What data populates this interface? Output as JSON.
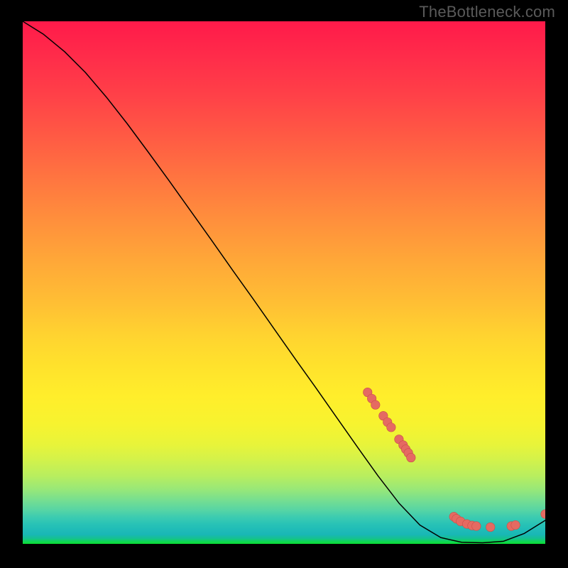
{
  "watermark": "TheBottleneck.com",
  "colors": {
    "curve": "#000000",
    "dot_fill": "#e56a62",
    "dot_stroke": "#c84f48",
    "bg_top": "#ff1a4a",
    "bg_bottom": "#0ce032",
    "page_bg": "#000000"
  },
  "chart_data": {
    "type": "line",
    "title": "",
    "xlabel": "",
    "ylabel": "",
    "xlim": [
      0,
      100
    ],
    "ylim": [
      0,
      100
    ],
    "grid": false,
    "legend": false,
    "curve": [
      {
        "x": 0.0,
        "y": 100.0
      },
      {
        "x": 4.0,
        "y": 97.5
      },
      {
        "x": 8.0,
        "y": 94.2
      },
      {
        "x": 12.0,
        "y": 90.2
      },
      {
        "x": 16.0,
        "y": 85.5
      },
      {
        "x": 20.0,
        "y": 80.4
      },
      {
        "x": 24.0,
        "y": 75.0
      },
      {
        "x": 28.0,
        "y": 69.5
      },
      {
        "x": 32.0,
        "y": 63.9
      },
      {
        "x": 36.0,
        "y": 58.3
      },
      {
        "x": 40.0,
        "y": 52.6
      },
      {
        "x": 44.0,
        "y": 47.0
      },
      {
        "x": 48.0,
        "y": 41.3
      },
      {
        "x": 52.0,
        "y": 35.6
      },
      {
        "x": 56.0,
        "y": 30.0
      },
      {
        "x": 60.0,
        "y": 24.3
      },
      {
        "x": 64.0,
        "y": 18.6
      },
      {
        "x": 68.0,
        "y": 13.0
      },
      {
        "x": 72.0,
        "y": 7.8
      },
      {
        "x": 76.0,
        "y": 3.6
      },
      {
        "x": 80.0,
        "y": 1.2
      },
      {
        "x": 84.0,
        "y": 0.3
      },
      {
        "x": 88.0,
        "y": 0.2
      },
      {
        "x": 92.0,
        "y": 0.5
      },
      {
        "x": 96.0,
        "y": 2.0
      },
      {
        "x": 100.0,
        "y": 4.5
      }
    ],
    "dots": [
      {
        "x": 66.0,
        "y": 29.0
      },
      {
        "x": 66.8,
        "y": 27.8
      },
      {
        "x": 67.5,
        "y": 26.6
      },
      {
        "x": 69.0,
        "y": 24.5
      },
      {
        "x": 69.8,
        "y": 23.3
      },
      {
        "x": 70.5,
        "y": 22.3
      },
      {
        "x": 72.0,
        "y": 20.0
      },
      {
        "x": 72.8,
        "y": 18.9
      },
      {
        "x": 73.3,
        "y": 18.1
      },
      {
        "x": 73.8,
        "y": 17.4
      },
      {
        "x": 74.3,
        "y": 16.5
      },
      {
        "x": 82.5,
        "y": 5.2
      },
      {
        "x": 83.0,
        "y": 4.8
      },
      {
        "x": 83.8,
        "y": 4.3
      },
      {
        "x": 85.0,
        "y": 3.8
      },
      {
        "x": 86.0,
        "y": 3.5
      },
      {
        "x": 86.8,
        "y": 3.4
      },
      {
        "x": 89.5,
        "y": 3.2
      },
      {
        "x": 93.5,
        "y": 3.4
      },
      {
        "x": 94.3,
        "y": 3.6
      },
      {
        "x": 100.0,
        "y": 5.7
      }
    ]
  }
}
